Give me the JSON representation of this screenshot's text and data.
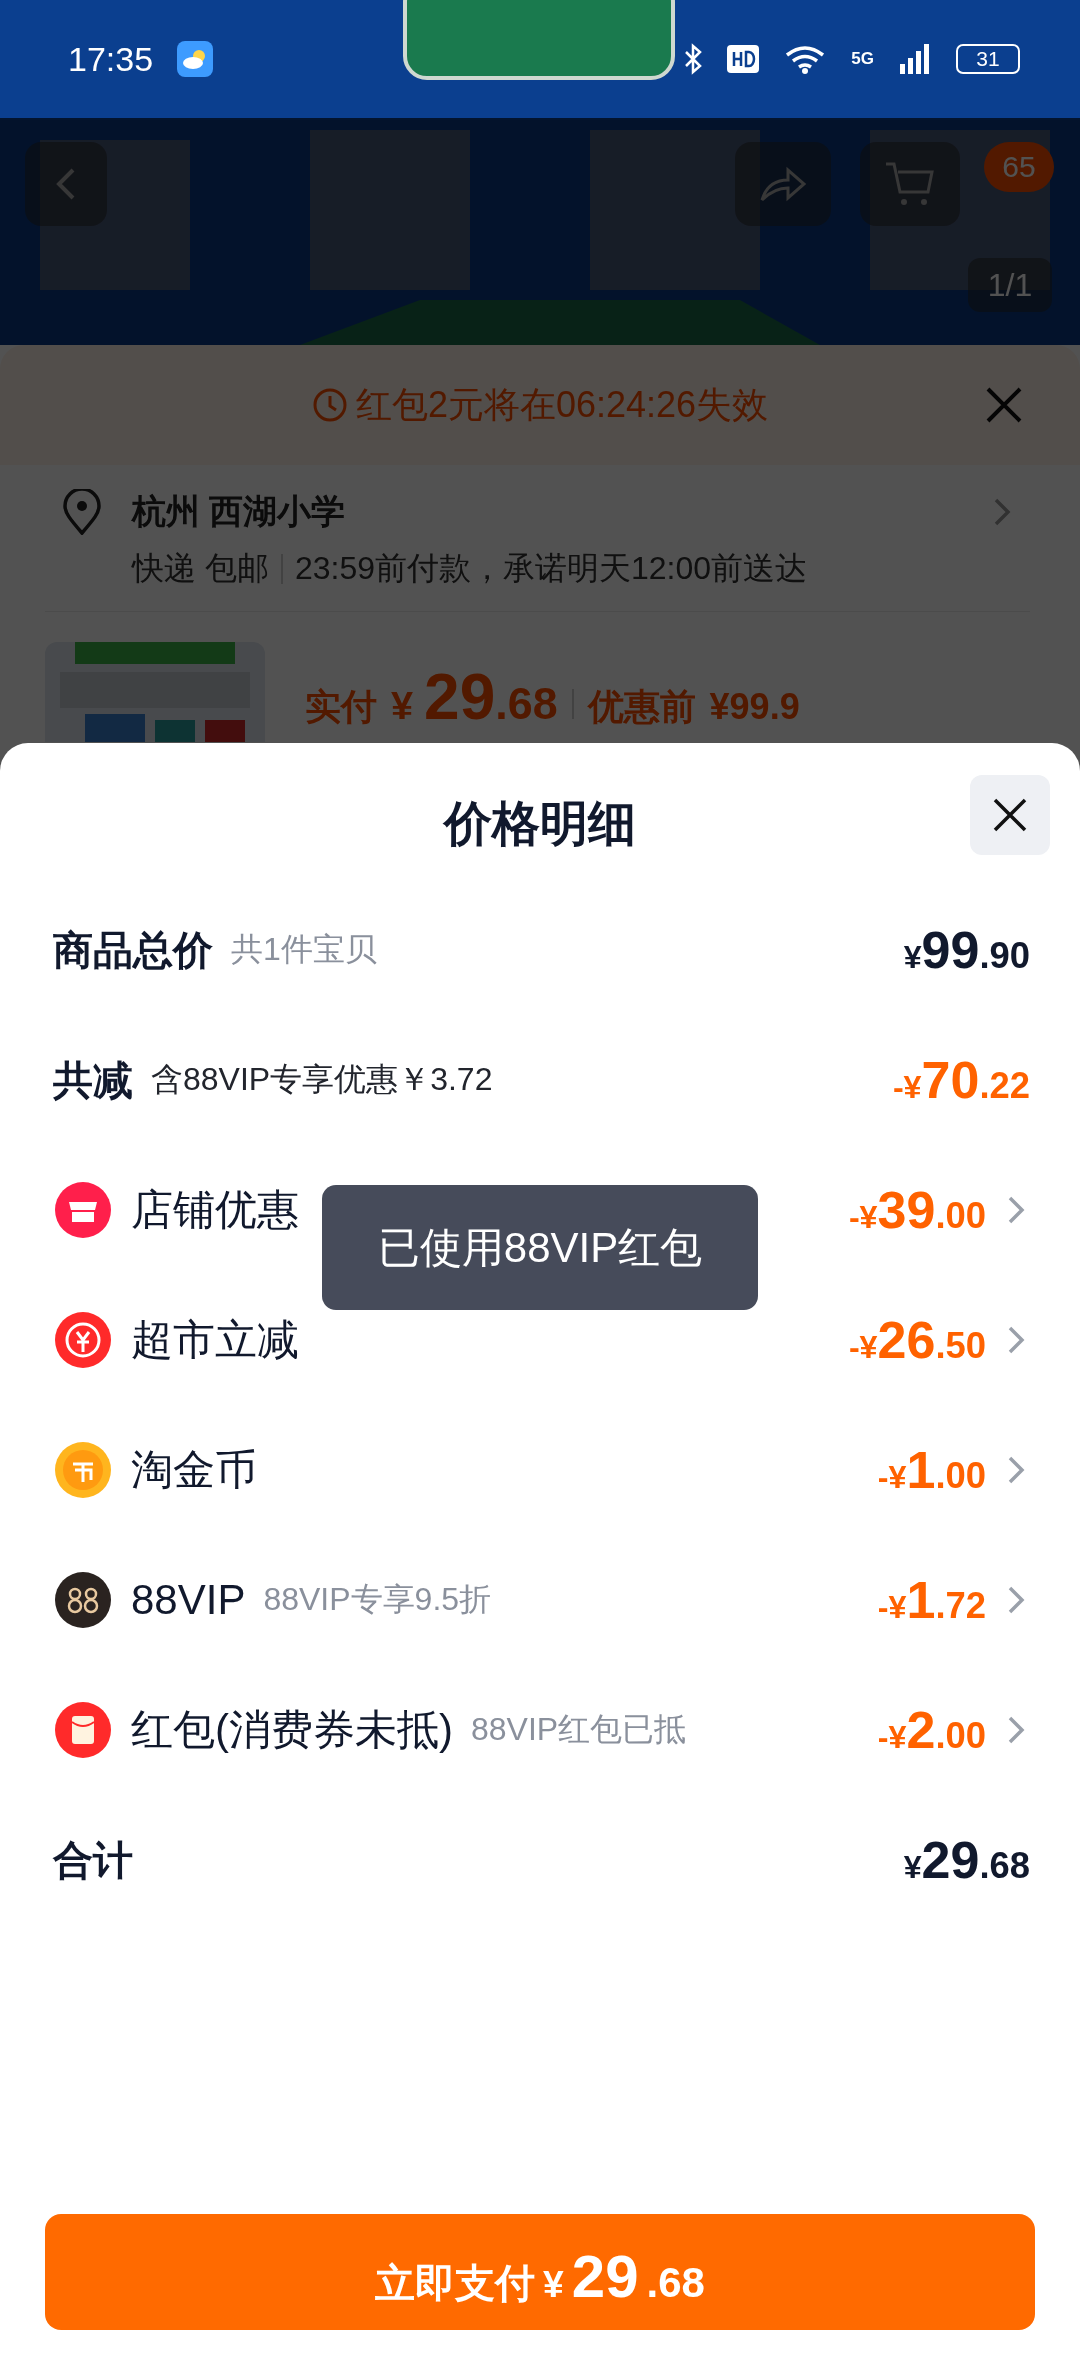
{
  "status_bar": {
    "time": "17:35",
    "network": "5G",
    "battery": "31"
  },
  "top_bar": {
    "cart_badge": "65",
    "image_counter": "1/1"
  },
  "order_sheet": {
    "timer_notice": "红包2元将在06:24:26失效",
    "address": "杭州 西湖小学",
    "delivery": [
      "快递 包邮",
      "23:59前付款，承诺明天12:00前送达"
    ],
    "pay_label": "实付",
    "pay_amount": "¥ 29.68",
    "before_label": "优惠前",
    "before_amount": "¥99.9"
  },
  "price_detail": {
    "title": "价格明细",
    "rows": [
      {
        "kind": "summary",
        "label": "商品总价",
        "note": "共1件宝贝",
        "amount": "¥99.90",
        "discount": false
      },
      {
        "kind": "summary",
        "label": "共减",
        "note": "含88VIP专享优惠￥3.72",
        "amount": "-¥70.22",
        "discount": true
      },
      {
        "kind": "item",
        "label": "店铺优惠",
        "amount": "-¥39.00",
        "discount": true
      },
      {
        "kind": "item",
        "label": "超市立减",
        "amount": "-¥26.50",
        "discount": true
      },
      {
        "kind": "item",
        "label": "淘金币",
        "amount": "-¥1.00",
        "discount": true
      },
      {
        "kind": "item",
        "label": "88VIP",
        "note": "88VIP专享9.5折",
        "amount": "-¥1.72",
        "discount": true
      },
      {
        "kind": "item",
        "label": "红包(消费券未抵)",
        "note": "88VIP红包已抵",
        "amount": "-¥2.00",
        "discount": true
      },
      {
        "kind": "total",
        "label": "合计",
        "amount": "¥29.68",
        "discount": false
      }
    ],
    "toast": "已使用88VIP红包",
    "pay_button": {
      "label": "立即支付",
      "amount": "¥29.68"
    }
  }
}
